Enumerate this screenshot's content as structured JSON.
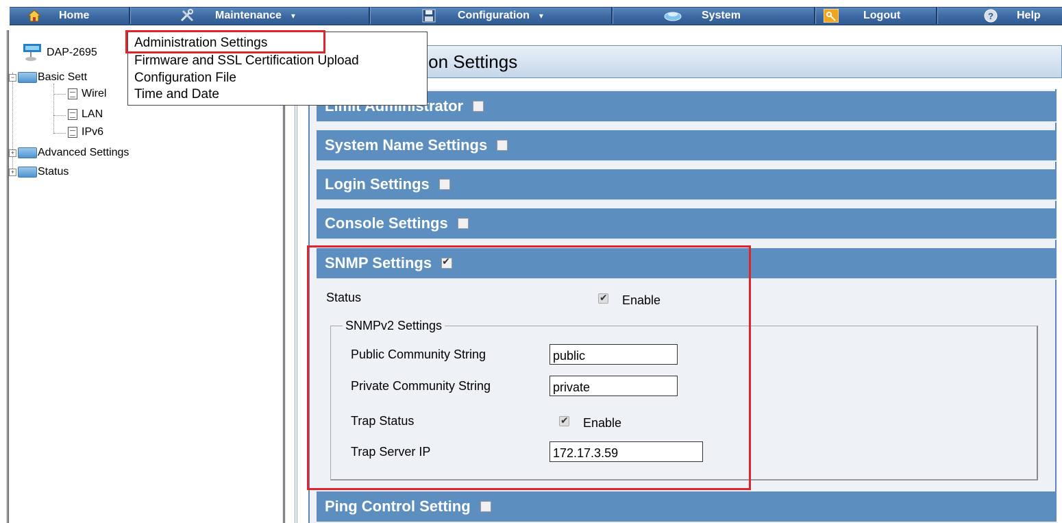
{
  "menu": {
    "home": "Home",
    "maintenance": "Maintenance",
    "configuration": "Configuration",
    "system": "System",
    "logout": "Logout",
    "help": "Help",
    "caret": "▾"
  },
  "dropdown": {
    "items": [
      "Administration Settings",
      "Firmware and SSL Certification Upload",
      "Configuration File",
      "Time and Date"
    ]
  },
  "tree": {
    "device": "DAP-2695",
    "basic_settings": "Basic Sett",
    "wireless": "Wirel",
    "lan": "LAN",
    "ipv6": "IPv6",
    "advanced_settings": "Advanced Settings",
    "status": "Status"
  },
  "content": {
    "page_title": "ration Settings",
    "sections": {
      "limit_admin": "Limit Administrator",
      "system_name": "System Name Settings",
      "login": "Login Settings",
      "console": "Console Settings",
      "snmp": "SNMP Settings",
      "ping": "Ping Control Setting"
    },
    "snmp": {
      "status_label": "Status",
      "enable_label": "Enable",
      "status_enabled": true,
      "fieldset_legend": "SNMPv2 Settings",
      "public_label": "Public Community String",
      "public_value": "public",
      "private_label": "Private Community String",
      "private_value": "private",
      "trap_status_label": "Trap Status",
      "trap_enable_label": "Enable",
      "trap_enabled": true,
      "trap_server_label": "Trap Server IP",
      "trap_server_value": "172.17.3.59"
    }
  },
  "colors": {
    "menu_bar": "#3e6aa3",
    "section_header": "#5c8ebf",
    "highlight": "#e0232c"
  }
}
